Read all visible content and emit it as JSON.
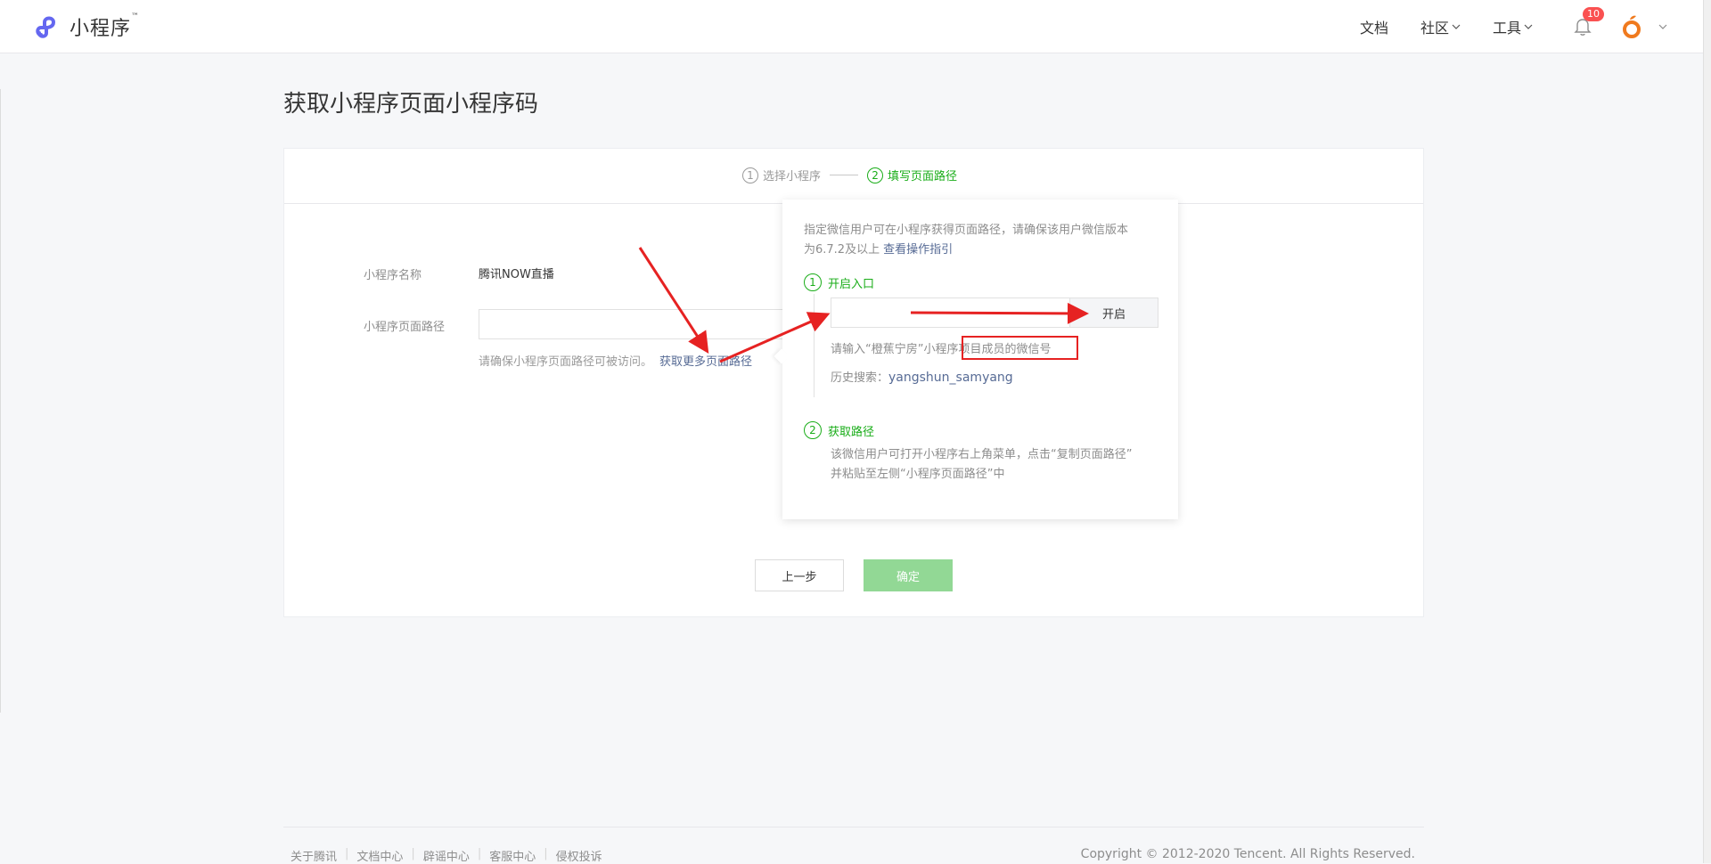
{
  "header": {
    "logo_text": "小程序",
    "logo_tm": "™",
    "nav": [
      {
        "label": "文档"
      },
      {
        "label": "社区"
      },
      {
        "label": "工具"
      }
    ],
    "notification_count": "10"
  },
  "page": {
    "title": "获取小程序页面小程序码"
  },
  "steps": [
    {
      "num": "1",
      "label": "选择小程序"
    },
    {
      "num": "2",
      "label": "填写页面路径"
    }
  ],
  "form": {
    "name_label": "小程序名称",
    "name_value": "腾讯NOW直播",
    "path_label": "小程序页面路径",
    "hint_text": "请确保小程序页面路径可被访问。",
    "hint_link": "获取更多页面路径"
  },
  "buttons": {
    "prev": "上一步",
    "confirm": "确定"
  },
  "popover": {
    "intro_line1": "指定微信用户可在小程序获得页面路径，请确保该用户微信版本",
    "intro_line2": "为6.7.2及以上",
    "intro_link": "查看操作指引",
    "step1_num": "1",
    "step1_title": "开启入口",
    "open_button": "开启",
    "input_hint": "请输入“橙蕉宁房”小程序项目成员的微信号",
    "history_label": "历史搜索：",
    "history_value": "yangshun_samyang",
    "step2_num": "2",
    "step2_title": "获取路径",
    "step2_line1": "该微信用户可打开小程序右上角菜单，点击“复制页面路径”",
    "step2_line2": "并粘贴至左侧“小程序页面路径”中"
  },
  "footer": {
    "links": [
      "关于腾讯",
      "文档中心",
      "辟谣中心",
      "客服中心",
      "侵权投诉"
    ],
    "copyright": "Copyright © 2012-2020 Tencent. All Rights Reserved."
  },
  "colors": {
    "brand_green": "#1aad19",
    "link_blue": "#576b95",
    "annotation_red": "#e62222",
    "badge_red": "#fa5151"
  }
}
